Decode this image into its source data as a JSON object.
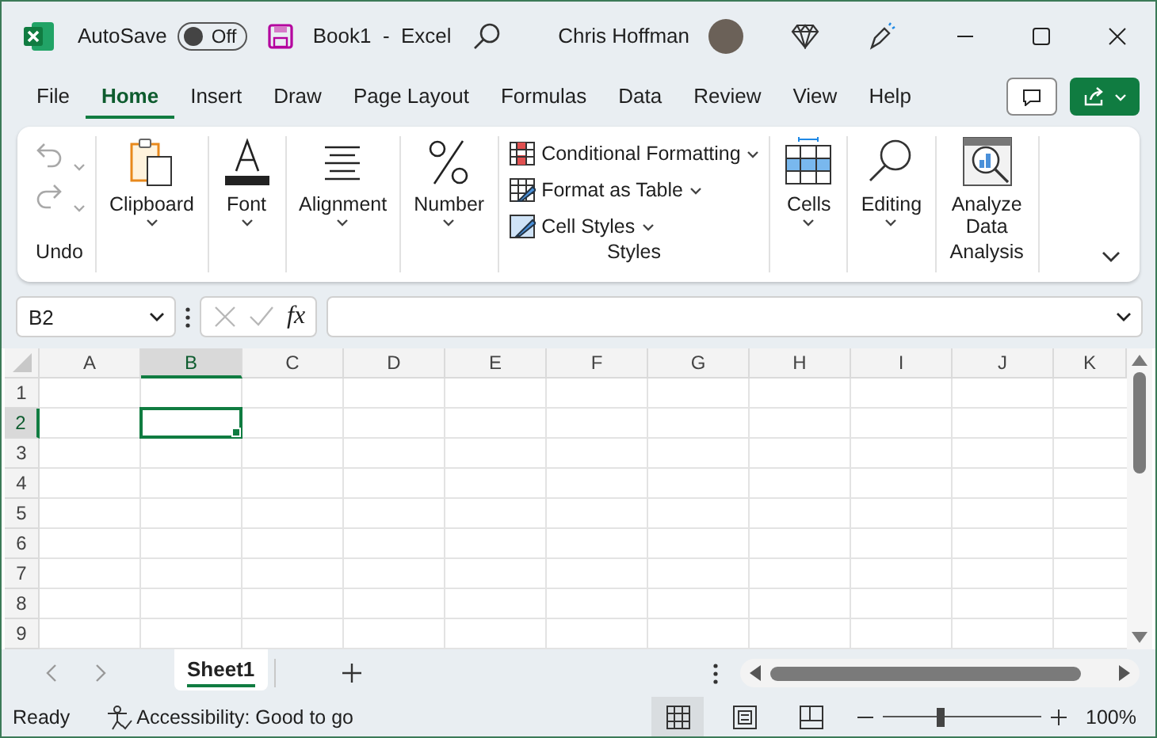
{
  "window": {
    "title": "Book1  -  Excel",
    "autosave": {
      "label": "AutoSave",
      "on": false,
      "state_text": "Off"
    },
    "user": "Chris Hoffman"
  },
  "tabs": [
    {
      "label": "File",
      "selected": false
    },
    {
      "label": "Home",
      "selected": true
    },
    {
      "label": "Insert",
      "selected": false
    },
    {
      "label": "Draw",
      "selected": false
    },
    {
      "label": "Page Layout",
      "selected": false
    },
    {
      "label": "Formulas",
      "selected": false
    },
    {
      "label": "Data",
      "selected": false
    },
    {
      "label": "Review",
      "selected": false
    },
    {
      "label": "View",
      "selected": false
    },
    {
      "label": "Help",
      "selected": false
    }
  ],
  "ribbon": {
    "groups": [
      {
        "kind": "undo",
        "label": "Undo",
        "items": [
          {
            "disabled": true
          },
          {
            "disabled": true
          }
        ]
      },
      {
        "kind": "big",
        "items": [
          {
            "label": "Clipboard",
            "dropdown": true
          }
        ]
      },
      {
        "kind": "big",
        "items": [
          {
            "label": "Font",
            "dropdown": true
          }
        ]
      },
      {
        "kind": "big",
        "items": [
          {
            "label": "Alignment",
            "dropdown": true
          }
        ]
      },
      {
        "kind": "big",
        "items": [
          {
            "label": "Number",
            "dropdown": true
          }
        ]
      },
      {
        "kind": "list",
        "label": "Styles",
        "items": [
          {
            "label": "Conditional Formatting",
            "dropdown": true
          },
          {
            "label": "Format as Table",
            "dropdown": true
          },
          {
            "label": "Cell Styles",
            "dropdown": true
          }
        ]
      },
      {
        "kind": "big",
        "items": [
          {
            "label": "Cells",
            "dropdown": true
          }
        ]
      },
      {
        "kind": "big",
        "items": [
          {
            "label": "Editing",
            "dropdown": true
          }
        ]
      },
      {
        "kind": "big",
        "label": "Analysis",
        "items": [
          {
            "label": "Analyze Data",
            "dropdown": false
          }
        ]
      }
    ]
  },
  "formula_bar": {
    "name_box": "B2",
    "insert_function": "fx"
  },
  "grid": {
    "columns": [
      {
        "label": "A",
        "selected": false
      },
      {
        "label": "B",
        "selected": true
      },
      {
        "label": "C",
        "selected": false
      },
      {
        "label": "D",
        "selected": false
      },
      {
        "label": "E",
        "selected": false
      },
      {
        "label": "F",
        "selected": false
      },
      {
        "label": "G",
        "selected": false
      },
      {
        "label": "H",
        "selected": false
      },
      {
        "label": "I",
        "selected": false
      },
      {
        "label": "J",
        "selected": false
      },
      {
        "label": "K",
        "selected": false
      }
    ],
    "rows": [
      {
        "label": "1",
        "selected": false
      },
      {
        "label": "2",
        "selected": true
      },
      {
        "label": "3",
        "selected": false
      },
      {
        "label": "4",
        "selected": false
      },
      {
        "label": "5",
        "selected": false
      },
      {
        "label": "6",
        "selected": false
      },
      {
        "label": "7",
        "selected": false
      },
      {
        "label": "8",
        "selected": false
      },
      {
        "label": "9",
        "selected": false
      }
    ]
  },
  "sheets": [
    {
      "label": "Sheet1",
      "selected": true
    }
  ],
  "status_bar": {
    "ready": "Ready",
    "accessibility": "Accessibility: Good to go",
    "views": [
      {
        "kind": "normal",
        "selected": true
      },
      {
        "kind": "page_layout",
        "selected": false
      },
      {
        "kind": "page_break",
        "selected": false
      }
    ],
    "zoom": {
      "level": 0.36,
      "reading": "100%"
    }
  }
}
